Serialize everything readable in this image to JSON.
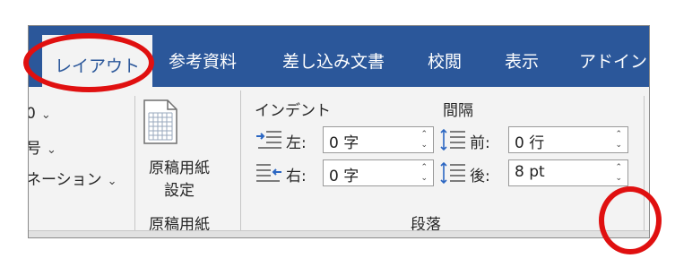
{
  "tabs": {
    "layout": "レイアウト",
    "references": "参考資料",
    "mailings": "差し込み文書",
    "review": "校閲",
    "view": "表示",
    "addins": "アドイン"
  },
  "page_setup_partial": {
    "item1": "0",
    "item2": "号",
    "item3": "ネーション"
  },
  "genkou": {
    "button_line1": "原稿用紙",
    "button_line2": "設定",
    "group_label": "原稿用紙"
  },
  "paragraph": {
    "indent_header": "インデント",
    "spacing_header": "間隔",
    "left_label": "左:",
    "left_value": "0 字",
    "right_label": "右:",
    "right_value": "0 字",
    "before_label": "前:",
    "before_value": "0 行",
    "after_label": "後:",
    "after_value": "8 pt",
    "group_label": "段落"
  },
  "colors": {
    "ribbon_blue": "#2b579a",
    "highlight_red": "#e01010"
  }
}
